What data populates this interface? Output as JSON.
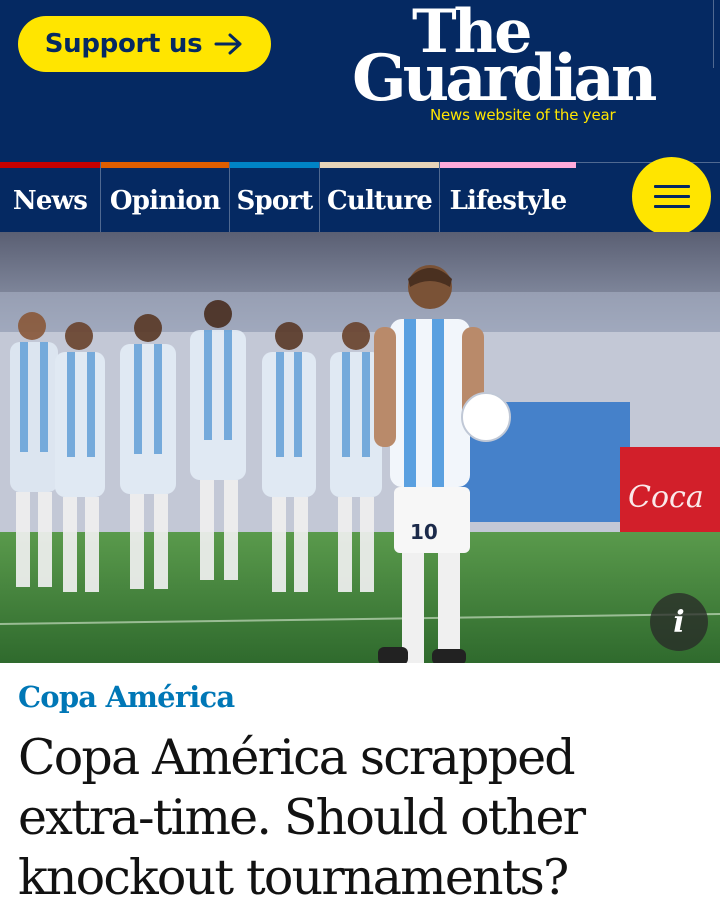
{
  "header": {
    "support_label": "Support us",
    "logo_line1": "The",
    "logo_line2": "Guardian",
    "tagline": "News website of the year"
  },
  "nav": {
    "items": [
      {
        "label": "News",
        "color": "#c70000"
      },
      {
        "label": "Opinion",
        "color": "#e05e00"
      },
      {
        "label": "Sport",
        "color": "#0084c6"
      },
      {
        "label": "Culture",
        "color": "#e7d4b9"
      },
      {
        "label": "Lifestyle",
        "color": "#ffabdb"
      }
    ],
    "menu_icon": "hamburger-icon"
  },
  "hero": {
    "info_label": "i",
    "jersey_number": "10"
  },
  "article": {
    "kicker": "Copa América",
    "headline": "Copa América scrapped extra-time. Should other knockout tournaments?"
  },
  "colors": {
    "brand_navy": "#052962",
    "brand_yellow": "#ffe500",
    "kicker_blue": "#0077b6"
  }
}
